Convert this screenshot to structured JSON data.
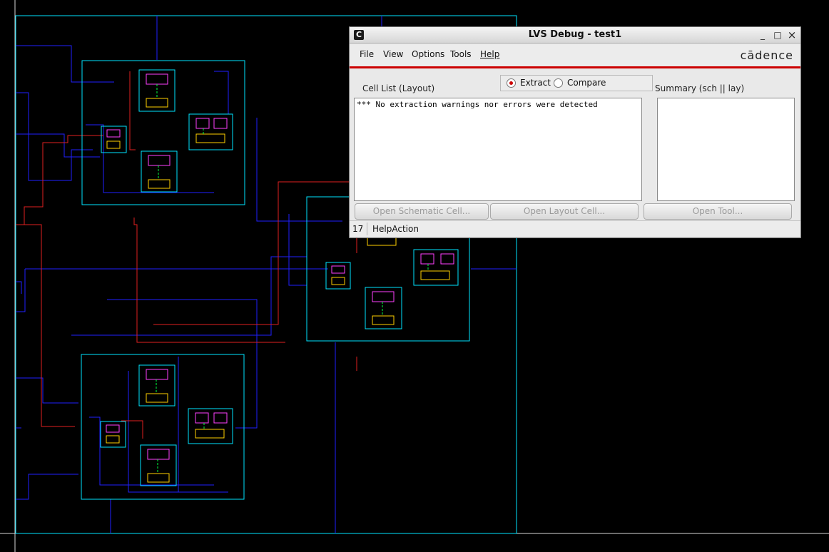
{
  "window": {
    "app_icon": "C",
    "title": "LVS Debug - test1",
    "controls": {
      "minimize": "_",
      "maximize": "□",
      "close": "×"
    }
  },
  "menu": {
    "items": [
      {
        "label": "File"
      },
      {
        "label": "View"
      },
      {
        "label": "Options"
      },
      {
        "label": "Tools"
      },
      {
        "label": "Help"
      }
    ],
    "brand": "cādence"
  },
  "mode": {
    "options": [
      {
        "label": "Extract",
        "selected": true
      },
      {
        "label": "Compare",
        "selected": false
      }
    ]
  },
  "cell_list": {
    "label": "Cell List (Layout)",
    "content": "*** No extraction warnings nor errors were detected"
  },
  "summary": {
    "label": "Summary (sch || lay)",
    "content": ""
  },
  "buttons": {
    "open_schematic": "Open Schematic Cell...",
    "open_layout": "Open Layout Cell...",
    "open_tool": "Open Tool..."
  },
  "status": {
    "number": "17",
    "text": "HelpAction"
  },
  "colors": {
    "canvas_bg": "#000000",
    "cell_boundary": "#00e5ff",
    "metal1_wire": "#2020ff",
    "metal2_wire": "#e02020",
    "accent_red": "#cc0000",
    "via_green": "#00ff40",
    "pin_yellow": "#ffd000",
    "diffusion_magenta": "#ff40ff"
  }
}
